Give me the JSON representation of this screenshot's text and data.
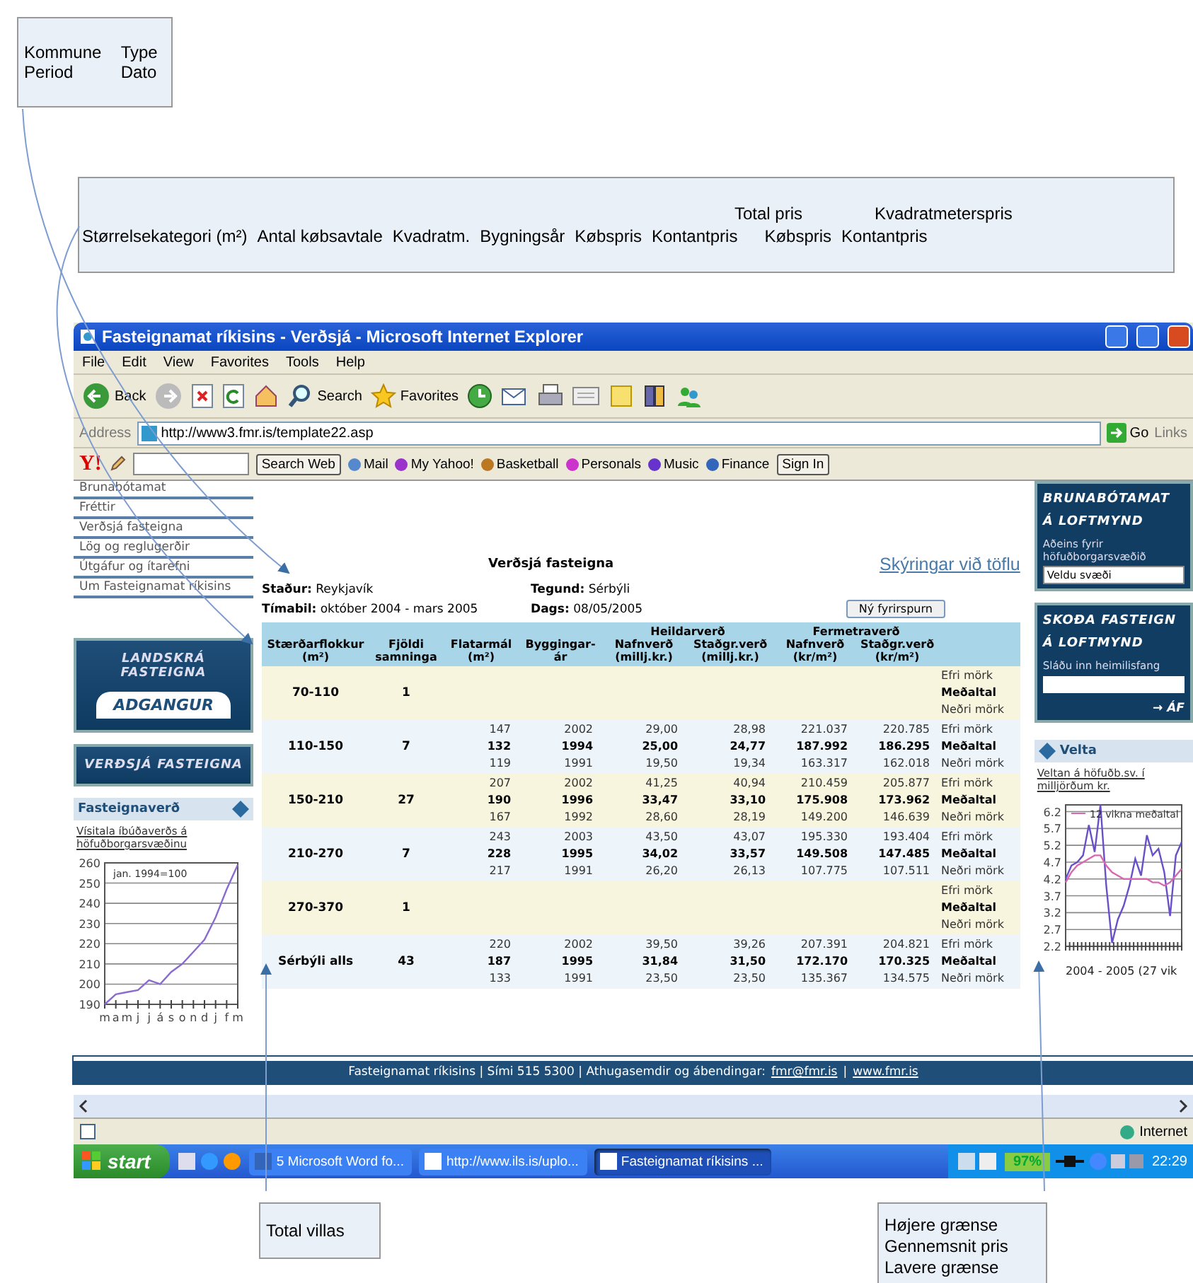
{
  "callout_top_left": {
    "items": [
      "Kommune",
      "Type",
      "Period",
      "Dato"
    ]
  },
  "callout_headers": {
    "groups": [
      "Total pris",
      "Kvadratmeterspris"
    ],
    "columns": [
      "Størrelsekategori (m²)",
      "Antal købsavtale",
      "Kvadratm.",
      "Bygningsår",
      "Købspris",
      "Kontantpris",
      "Købspris",
      "Kontantpris"
    ]
  },
  "window": {
    "title": "Fasteignamat ríkisins - Verðsjá - Microsoft Internet Explorer"
  },
  "menu": [
    "File",
    "Edit",
    "View",
    "Favorites",
    "Tools",
    "Help"
  ],
  "toolbar": [
    {
      "kind": "back",
      "label": "Back"
    },
    {
      "kind": "forward"
    },
    {
      "kind": "stop"
    },
    {
      "kind": "refresh"
    },
    {
      "kind": "home"
    },
    {
      "kind": "search",
      "label": "Search"
    },
    {
      "kind": "favorites",
      "label": "Favorites"
    },
    {
      "kind": "history"
    },
    {
      "kind": "mail"
    },
    {
      "kind": "print"
    },
    {
      "kind": "edit"
    },
    {
      "kind": "folder"
    },
    {
      "kind": "research"
    },
    {
      "kind": "messenger"
    }
  ],
  "address": {
    "label": "Address",
    "url": "http://www3.fmr.is/template22.asp",
    "go": "Go",
    "links": "Links"
  },
  "yahoo_bar": {
    "logo": "Y!",
    "search_button": "Search Web",
    "items": [
      "Mail",
      "My Yahoo!",
      "Basketball",
      "Personals",
      "Music",
      "Finance"
    ],
    "sign_in": "Sign In"
  },
  "left_nav": [
    "Brunabótamat",
    "Fréttir",
    "Verðsjá fasteigna",
    "Lög og reglugerðir",
    "Útgáfur og ítarefni",
    "Um Fasteignamat ríkisins"
  ],
  "banners": {
    "registry": "LANDSKRÁ FASTEIGNA",
    "access": "ADGANGUR",
    "price_viewer": "VERÐSJÁ FASTEIGNA"
  },
  "price_panel": {
    "title": "Fasteignaverð",
    "link": "Vísitala íbúðaverðs á höfuðborgarsvæðinu",
    "note": "jan. 1994=100",
    "chart_data": {
      "type": "line",
      "grid": true,
      "categories": [
        "m",
        "a",
        "m",
        "j",
        "j",
        "á",
        "s",
        "o",
        "n",
        "d",
        "j",
        "f",
        "m"
      ],
      "values": [
        190,
        195,
        196,
        197,
        202,
        200,
        206,
        210,
        216,
        222,
        233,
        247,
        259
      ],
      "ylim": [
        190,
        260
      ],
      "yticks": [
        190,
        200,
        210,
        220,
        230,
        240,
        250,
        260
      ]
    }
  },
  "main": {
    "title": "Verðsjá fasteigna",
    "help_link": "Skýringar við töflu",
    "info": [
      {
        "label": "Staður:",
        "value": "Reykjavík"
      },
      {
        "label": "Tegund:",
        "value": "Sérbýli"
      },
      {
        "label": "Tímabil:",
        "value": "október 2004 - mars 2005"
      },
      {
        "label": "Dags:",
        "value": "08/05/2005"
      }
    ],
    "new_query_button": "Ný fyrirspurn"
  },
  "table": {
    "groups": [
      {
        "label": "Heildarverð"
      },
      {
        "label": "Fermetraverð"
      }
    ],
    "columns": [
      "Stærðarflokkur\n(m²)",
      "Fjöldi\nsamninga",
      "Flatarmál\n(m²)",
      "Byggingar-\nár",
      "Nafnverð\n(millj.kr.)",
      "Staðgr.verð\n(millj.kr.)",
      "Nafnverð\n(kr/m²)",
      "Staðgr.verð\n(kr/m²)"
    ],
    "rows": [
      {
        "category": "70-110",
        "contracts": "1",
        "lines": [
          {
            "kind": "bound",
            "label": "Efri mörk"
          },
          {
            "kind": "mean",
            "label": "Meðaltal"
          },
          {
            "kind": "bound",
            "label": "Neðri mörk"
          }
        ]
      },
      {
        "category": "110-150",
        "contracts": "7",
        "lines": [
          {
            "kind": "bound",
            "cells": [
              "147",
              "2002",
              "29,00",
              "28,98",
              "221.037",
              "220.785"
            ],
            "label": "Efri mörk"
          },
          {
            "kind": "mean",
            "cells": [
              "132",
              "1994",
              "25,00",
              "24,77",
              "187.992",
              "186.295"
            ],
            "label": "Meðaltal"
          },
          {
            "kind": "bound",
            "cells": [
              "119",
              "1991",
              "19,50",
              "19,34",
              "163.317",
              "162.018"
            ],
            "label": "Neðri mörk"
          }
        ]
      },
      {
        "category": "150-210",
        "contracts": "27",
        "lines": [
          {
            "kind": "bound",
            "cells": [
              "207",
              "2002",
              "41,25",
              "40,94",
              "210.459",
              "205.877"
            ],
            "label": "Efri mörk"
          },
          {
            "kind": "mean",
            "cells": [
              "190",
              "1996",
              "33,47",
              "33,10",
              "175.908",
              "173.962"
            ],
            "label": "Meðaltal"
          },
          {
            "kind": "bound",
            "cells": [
              "167",
              "1992",
              "28,60",
              "28,19",
              "149.200",
              "146.639"
            ],
            "label": "Neðri mörk"
          }
        ]
      },
      {
        "category": "210-270",
        "contracts": "7",
        "lines": [
          {
            "kind": "bound",
            "cells": [
              "243",
              "2003",
              "43,50",
              "43,07",
              "195.330",
              "193.404"
            ],
            "label": "Efri mörk"
          },
          {
            "kind": "mean",
            "cells": [
              "228",
              "1995",
              "34,02",
              "33,57",
              "149.508",
              "147.485"
            ],
            "label": "Meðaltal"
          },
          {
            "kind": "bound",
            "cells": [
              "217",
              "1991",
              "26,20",
              "26,13",
              "107.775",
              "107.511"
            ],
            "label": "Neðri mörk"
          }
        ]
      },
      {
        "category": "270-370",
        "contracts": "1",
        "lines": [
          {
            "kind": "bound",
            "label": "Efri mörk"
          },
          {
            "kind": "mean",
            "label": "Meðaltal"
          },
          {
            "kind": "bound",
            "label": "Neðri mörk"
          }
        ]
      },
      {
        "category": "Sérbýli alls",
        "contracts": "43",
        "lines": [
          {
            "kind": "bound",
            "cells": [
              "220",
              "2002",
              "39,50",
              "39,26",
              "207.391",
              "204.821"
            ],
            "label": "Efri mörk"
          },
          {
            "kind": "mean",
            "cells": [
              "187",
              "1995",
              "31,84",
              "31,50",
              "172.170",
              "170.325"
            ],
            "label": "Meðaltal"
          },
          {
            "kind": "bound",
            "cells": [
              "133",
              "1991",
              "23,50",
              "23,50",
              "135.367",
              "134.575"
            ],
            "label": "Neðri mörk"
          }
        ]
      }
    ]
  },
  "right_panels": {
    "fire_title": [
      "BRUNABÓTAMAT",
      "Á LOFTMYND"
    ],
    "fire_note": "Aðeins fyrir höfuðborgarsvæðið",
    "area_select": "Veldu svæði",
    "view_title": [
      "SKOÐA FASTEIGN",
      "Á LOFTMYND"
    ],
    "address_hint": "Sláðu inn heimilisfang",
    "go_link": "→ ÁF"
  },
  "turnover_panel": {
    "title": "Velta",
    "link": "Veltan á höfuðb.sv. í milljörðum kr.",
    "chart_data": {
      "type": "line",
      "grid": true,
      "xlabel": "2004 - 2005 (27 vik",
      "ylim": [
        2.2,
        6.4
      ],
      "yticks": [
        2.2,
        2.7,
        3.2,
        3.7,
        4.2,
        4.7,
        5.2,
        5.7,
        6.2
      ],
      "series": [
        {
          "color": "#6a50c8",
          "values": [
            4.2,
            4.6,
            4.7,
            4.9,
            5.8,
            5.0,
            6.4,
            4.0,
            2.3,
            3.0,
            3.4,
            4.0,
            4.8,
            4.3,
            5.5,
            4.9,
            5.1,
            4.4,
            3.1,
            4.9,
            5.3
          ]
        },
        {
          "name": "12 vikna meðaltal",
          "color": "#d868b0",
          "values": [
            4.1,
            4.4,
            4.6,
            4.7,
            4.8,
            4.9,
            4.9,
            4.6,
            4.4,
            4.3,
            4.2,
            4.2,
            4.2,
            4.2,
            4.2,
            4.1,
            4.1,
            4.0,
            4.1,
            4.3,
            4.5
          ]
        }
      ]
    }
  },
  "footer": {
    "text": "Fasteignamat ríkisins | Sími 515 5300 | Athugasemdir og ábendingar:",
    "email": "fmr@fmr.is",
    "separator": "|",
    "site": "www.fmr.is"
  },
  "status_bar": {
    "zone": "Internet"
  },
  "taskbar": {
    "start": "start",
    "tasks": [
      {
        "label": "5 Microsoft Word fo...",
        "selected": false
      },
      {
        "label": "http://www.ils.is/uplo...",
        "selected": false
      },
      {
        "label": "Fasteignamat ríkisins ...",
        "selected": true
      }
    ],
    "battery": "97%",
    "clock": "22:29"
  },
  "callout_bottom_left": {
    "text": "Total villas"
  },
  "callout_bottom_right": {
    "lines": [
      "Højere grænse",
      "Gennemsnit pris",
      "Lavere grænse"
    ]
  }
}
